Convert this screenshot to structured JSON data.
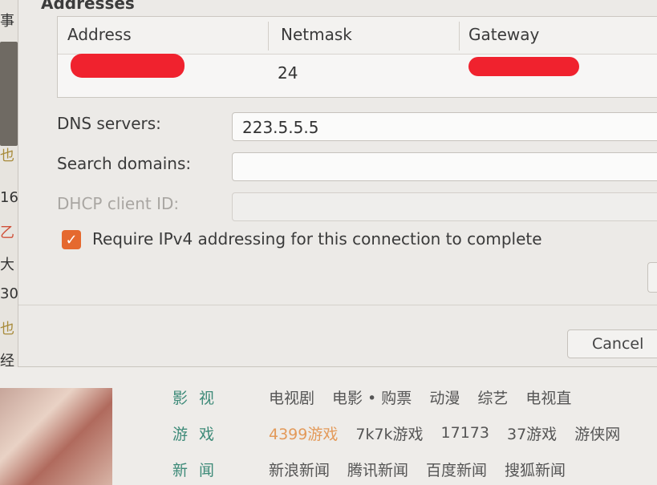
{
  "dialog": {
    "section_title": "Addresses",
    "table": {
      "headers": {
        "address": "Address",
        "netmask": "Netmask",
        "gateway": "Gateway"
      },
      "rows": [
        {
          "address": "",
          "netmask": "24",
          "gateway": ""
        }
      ]
    },
    "dns_label": "DNS servers:",
    "dns_value": "223.5.5.5",
    "search_label": "Search domains:",
    "search_value": "",
    "dhcp_label": "DHCP client ID:",
    "dhcp_value": "",
    "require_ipv4_label": "Require IPv4 addressing for this connection to complete",
    "require_ipv4_checked": true,
    "cancel_label": "Cancel",
    "accent_color": "#e5692f",
    "redaction_color": "#f0222e"
  },
  "left_strip": {
    "fragments": [
      "事",
      "也",
      "16",
      "乙",
      "大",
      "30",
      "也",
      "经"
    ]
  },
  "browser": {
    "rows": [
      {
        "category": "影 视",
        "links": [
          "电视剧",
          "电影 • 购票",
          "动漫",
          "综艺",
          "电视直"
        ]
      },
      {
        "category": "游 戏",
        "links": [
          "4399游戏",
          "7k7k游戏",
          "17173",
          "37游戏",
          "游侠网"
        ]
      },
      {
        "category": "新 闻",
        "links": [
          "新浪新闻",
          "腾讯新闻",
          "百度新闻",
          "搜狐新闻"
        ]
      }
    ]
  }
}
